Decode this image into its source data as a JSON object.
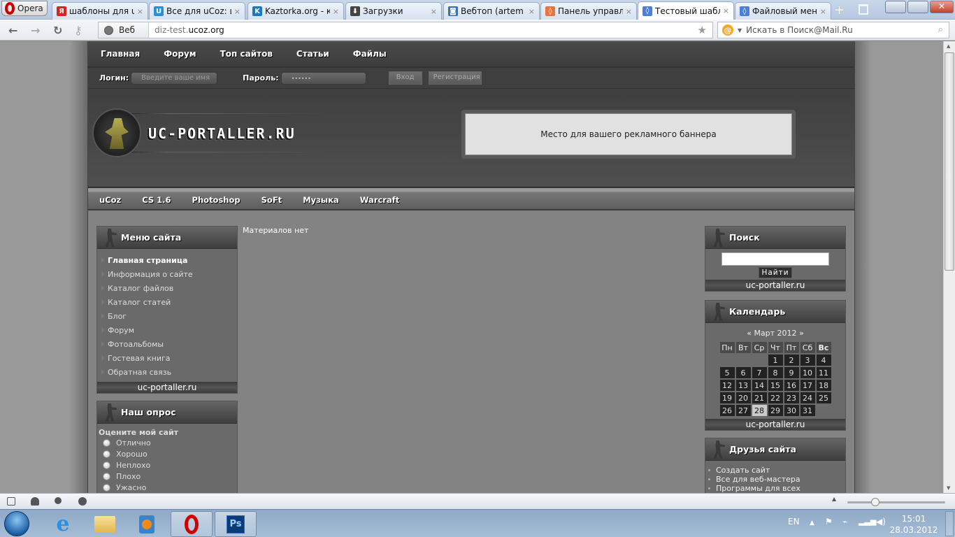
{
  "browser": {
    "menu_label": "Opera",
    "tabs": [
      {
        "title": "шаблоны для u...",
        "favicon": "yandex-icon",
        "color": "#e02020",
        "glyph": "Я"
      },
      {
        "title": "Все для uCoz: ш...",
        "favicon": "ucoz-icon",
        "color": "#2a8fd6",
        "glyph": "U"
      },
      {
        "title": "Kaztorka.org - ка...",
        "favicon": "kaztorka-icon",
        "color": "#1a78c2",
        "glyph": "K"
      },
      {
        "title": "Загрузки",
        "favicon": "downloads-icon",
        "color": "#444",
        "glyph": "⬇"
      },
      {
        "title": "Вебтоп (artem g...",
        "favicon": "webtop-icon",
        "color": "#3b6fb0",
        "glyph": "◙"
      },
      {
        "title": "Панель управл...",
        "favicon": "ucoz-orange-icon",
        "color": "#e8743b",
        "glyph": "◊"
      },
      {
        "title": "Тестовый шабл...",
        "favicon": "ucoz-blue-icon",
        "color": "#4d7fd6",
        "glyph": "◊",
        "active": true
      },
      {
        "title": "Файловый мен...",
        "favicon": "ucoz-blue-icon",
        "color": "#4d7fd6",
        "glyph": "◊"
      }
    ],
    "close_glyph": "×",
    "address": {
      "web_label": "Веб",
      "url_prefix": "diz-test.",
      "url_domain": "ucoz.org"
    },
    "search_placeholder": "Искать в Поиск@Mail.Ru"
  },
  "site": {
    "top_nav": [
      "Главная",
      "Форум",
      "Топ сайтов",
      "Статьи",
      "Файлы"
    ],
    "login": {
      "login_label": "Логин:",
      "login_placeholder": "Введите ваше имя",
      "password_label": "Пароль:",
      "password_value": "••••••",
      "enter_button": "Вход",
      "register_button": "Регистрация"
    },
    "logo_text": "UC-PORTALLER.RU",
    "banner_text": "Место для вашего рекламного баннера",
    "category_nav": [
      "uCoz",
      "CS 1.6",
      "Photoshop",
      "SoFt",
      "Музыка",
      "Warcraft"
    ],
    "main_content": "Материалов нет",
    "site_menu": {
      "title": "Меню сайта",
      "items": [
        "Главная страница",
        "Информация о сайте",
        "Каталог файлов",
        "Каталог статей",
        "Блог",
        "Форум",
        "Фотоальбомы",
        "Гостевая книга",
        "Обратная связь"
      ],
      "footer": "uc-portaller.ru"
    },
    "poll": {
      "title": "Наш опрос",
      "question": "Оцените мой сайт",
      "options": [
        "Отлично",
        "Хорошо",
        "Неплохо",
        "Плохо",
        "Ужасно"
      ]
    },
    "search": {
      "title": "Поиск",
      "button": "Найти",
      "footer": "uc-portaller.ru"
    },
    "calendar": {
      "title": "Календарь",
      "prev": "«",
      "next": "»",
      "month": "Март 2012",
      "weekdays": [
        "Пн",
        "Вт",
        "Ср",
        "Чт",
        "Пт",
        "Сб",
        "Вс"
      ],
      "weeks": [
        [
          "",
          "",
          "",
          "1",
          "2",
          "3",
          "4"
        ],
        [
          "5",
          "6",
          "7",
          "8",
          "9",
          "10",
          "11"
        ],
        [
          "12",
          "13",
          "14",
          "15",
          "16",
          "17",
          "18"
        ],
        [
          "19",
          "20",
          "21",
          "22",
          "23",
          "24",
          "25"
        ],
        [
          "26",
          "27",
          "28",
          "29",
          "30",
          "31",
          ""
        ]
      ],
      "today": "28",
      "footer": "uc-portaller.ru"
    },
    "friends": {
      "title": "Друзья сайта",
      "links": [
        "Создать сайт",
        "Все для веб-мастера",
        "Программы для всех"
      ]
    }
  },
  "taskbar": {
    "apps": [
      "internet-explorer-icon",
      "explorer-folder-icon",
      "media-player-icon",
      "opera-icon",
      "photoshop-icon"
    ],
    "lang": "EN",
    "time": "15:01",
    "date": "28.03.2012"
  }
}
